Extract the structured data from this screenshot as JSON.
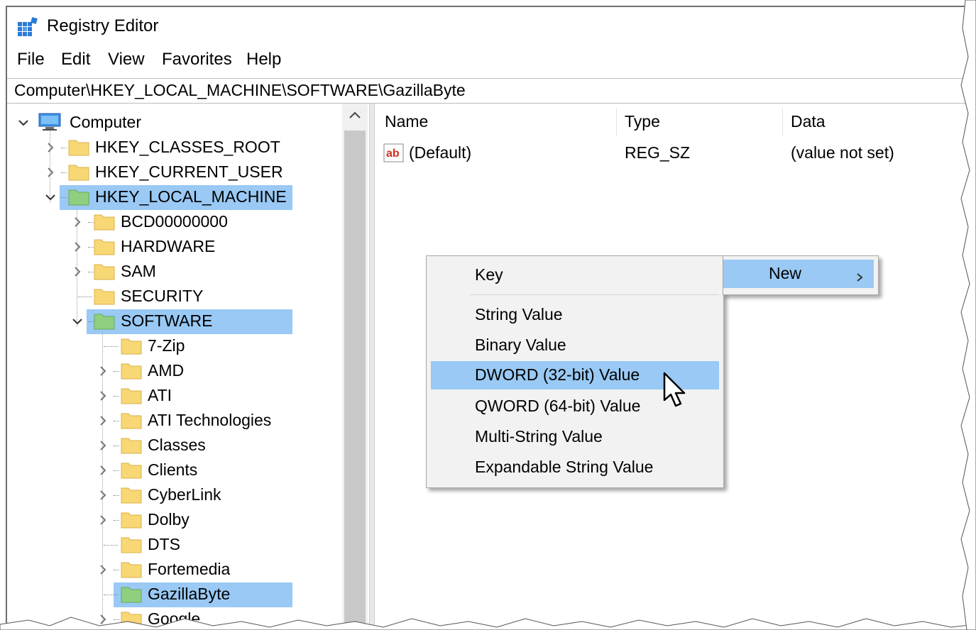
{
  "window": {
    "title": "Registry Editor"
  },
  "menu": [
    "File",
    "Edit",
    "View",
    "Favorites",
    "Help"
  ],
  "address": "Computer\\HKEY_LOCAL_MACHINE\\SOFTWARE\\GazillaByte",
  "tree": {
    "root": "Computer",
    "hives": [
      "HKEY_CLASSES_ROOT",
      "HKEY_CURRENT_USER",
      "HKEY_LOCAL_MACHINE"
    ],
    "hklm_children": [
      "BCD00000000",
      "HARDWARE",
      "SAM",
      "SECURITY",
      "SOFTWARE"
    ],
    "software_children": [
      "7-Zip",
      "AMD",
      "ATI",
      "ATI Technologies",
      "Classes",
      "Clients",
      "CyberLink",
      "Dolby",
      "DTS",
      "Fortemedia",
      "GazillaByte",
      "Google"
    ]
  },
  "list": {
    "columns": [
      "Name",
      "Type",
      "Data"
    ],
    "rows": [
      {
        "name": "(Default)",
        "type": "REG_SZ",
        "data": "(value not set)"
      }
    ]
  },
  "context_menu": {
    "items": [
      "Key",
      "String Value",
      "Binary Value",
      "DWORD (32-bit) Value",
      "QWORD (64-bit) Value",
      "Multi-String Value",
      "Expandable String Value"
    ],
    "highlighted": "DWORD (32-bit) Value"
  },
  "new_menu": {
    "label": "New"
  },
  "colors": {
    "selection": "#99c9f4",
    "menu_bg": "#f2f2f2",
    "folder": "#f8d775"
  }
}
